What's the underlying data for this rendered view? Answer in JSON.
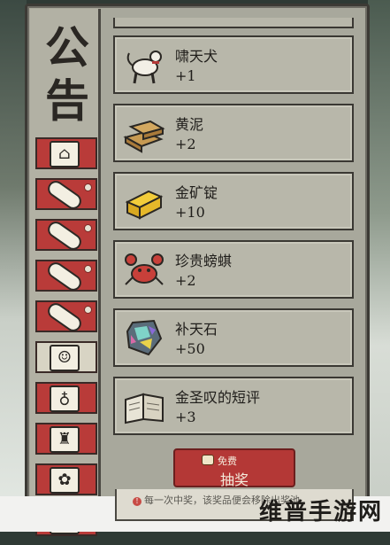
{
  "panel": {
    "title": "公告"
  },
  "tabs": [
    {
      "icon": "house-icon",
      "glyph": "⌂",
      "red": true,
      "dot": false
    },
    {
      "icon": "scroll-icon",
      "glyph": "",
      "red": true,
      "dot": true
    },
    {
      "icon": "scroll-icon",
      "glyph": "",
      "red": true,
      "dot": true
    },
    {
      "icon": "scroll-icon",
      "glyph": "",
      "red": true,
      "dot": true
    },
    {
      "icon": "scroll-icon",
      "glyph": "",
      "red": true,
      "dot": true
    },
    {
      "icon": "character-icon",
      "glyph": "☺",
      "red": false,
      "dot": false
    },
    {
      "icon": "bottle-icon",
      "glyph": "♁",
      "red": true,
      "dot": false
    },
    {
      "icon": "jar-icon",
      "glyph": "♜",
      "red": true,
      "dot": false
    },
    {
      "icon": "pouch-icon",
      "glyph": "✿",
      "red": true,
      "dot": false
    },
    {
      "icon": "box-icon",
      "glyph": "☗",
      "red": true,
      "dot": false
    }
  ],
  "rewards": [
    {
      "name": "啸天犬",
      "qty": "+1",
      "icon": "dog-icon"
    },
    {
      "name": "黄泥",
      "qty": "+2",
      "icon": "mud-bricks-icon"
    },
    {
      "name": "金矿锭",
      "qty": "+10",
      "icon": "gold-ingot-icon"
    },
    {
      "name": "珍贵螃蜞",
      "qty": "+2",
      "icon": "crab-icon"
    },
    {
      "name": "补天石",
      "qty": "+50",
      "icon": "gem-stone-icon"
    },
    {
      "name": "金圣叹的短评",
      "qty": "+3",
      "icon": "book-icon"
    }
  ],
  "draw": {
    "free_label": "免费",
    "label": "抽奖"
  },
  "footer": {
    "notice": "每一次中奖，该奖品便会移除出奖池"
  },
  "watermark": "维普手游网",
  "colors": {
    "accent_red": "#b43836",
    "card_bg": "#b8b7aa",
    "panel_bg": "#a8a89c"
  }
}
